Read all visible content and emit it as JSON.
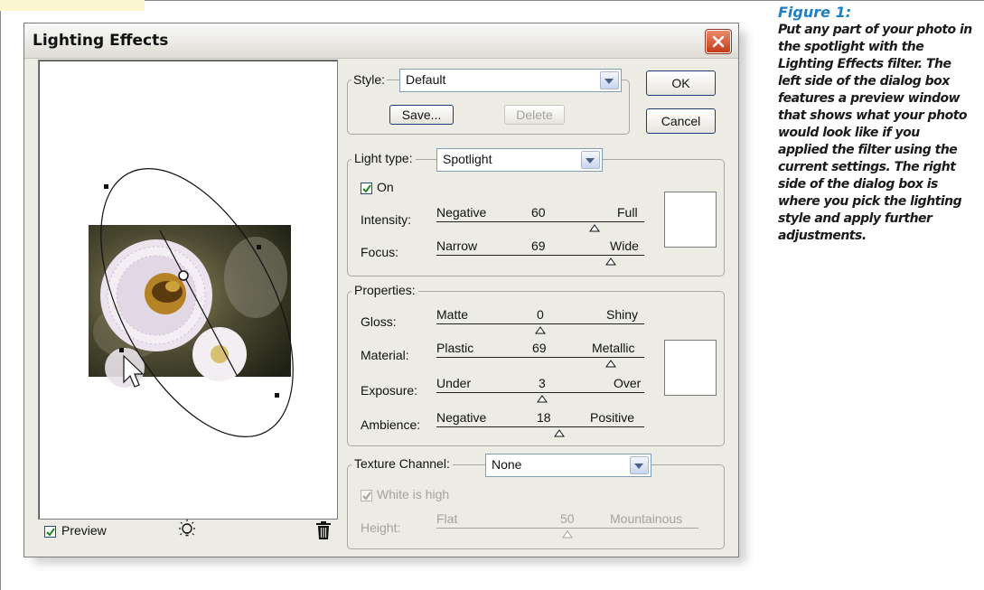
{
  "dialog": {
    "title": "Lighting Effects"
  },
  "style_section": {
    "label": "Style:",
    "selected": "Default",
    "save_label": "Save...",
    "delete_label": "Delete"
  },
  "buttons": {
    "ok_label": "OK",
    "cancel_label": "Cancel"
  },
  "light_type_section": {
    "label": "Light type:",
    "selected": "Spotlight",
    "on_label": "On",
    "on_checked": true,
    "sliders": [
      {
        "label": "Intensity:",
        "min_label": "Negative",
        "value": "60",
        "max_label": "Full",
        "position": 0.76
      },
      {
        "label": "Focus:",
        "min_label": "Narrow",
        "value": "69",
        "max_label": "Wide",
        "position": 0.84
      }
    ],
    "swatch_color": "#ffffff"
  },
  "properties_section": {
    "title": "Properties:",
    "sliders": [
      {
        "label": "Gloss:",
        "min_label": "Matte",
        "value": "0",
        "max_label": "Shiny",
        "position": 0.5
      },
      {
        "label": "Material:",
        "min_label": "Plastic",
        "value": "69",
        "max_label": "Metallic",
        "position": 0.84
      },
      {
        "label": "Exposure:",
        "min_label": "Under",
        "value": "3",
        "max_label": "Over",
        "position": 0.51
      },
      {
        "label": "Ambience:",
        "min_label": "Negative",
        "value": "18",
        "max_label": "Positive",
        "position": 0.59
      }
    ],
    "swatch_color": "#ffffff"
  },
  "texture_section": {
    "label": "Texture Channel:",
    "selected": "None",
    "white_is_high_label": "White is high",
    "white_is_high_checked": true,
    "height": {
      "label": "Height:",
      "min_label": "Flat",
      "value": "50",
      "max_label": "Mountainous",
      "position": 0.5
    }
  },
  "preview": {
    "label": "Preview",
    "checked": true,
    "light_bulb_icon": "light-bulb-icon",
    "trash_icon": "trash-icon"
  },
  "caption": {
    "title": "Figure 1:",
    "body": "Put any part of your photo in the spotlight with the Lighting Effects filter. The left side of the dialog box features a preview window that shows what your photo would look like if you applied the filter using the current settings. The right side of the dialog box is where you pick the lighting style and apply further adjustments."
  },
  "colors": {
    "caption_title": "#1f7fc4",
    "dialog_bg": "#ecebe4",
    "close_button": "#c33a17"
  }
}
